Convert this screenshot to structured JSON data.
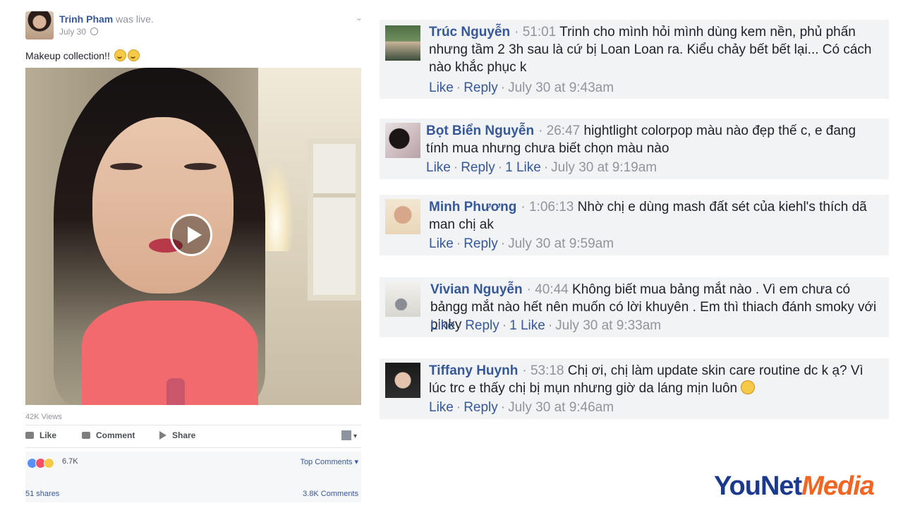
{
  "post": {
    "author": "Trinh Pham",
    "action": "was live.",
    "date": "July 30",
    "caption": "Makeup collection!!",
    "views": "42K Views",
    "actions": {
      "like": "Like",
      "comment": "Comment",
      "share": "Share"
    },
    "reaction_count": "6.7K",
    "top_comments": "Top Comments",
    "shares": "51 shares",
    "comments_count": "3.8K Comments"
  },
  "comments": [
    {
      "name": "Trúc Nguyễn",
      "timestamp": "51:01",
      "text": "Trinh cho mình hỏi mình dùng kem nền, phủ phấn nhưng tầm 2 3h sau là cứ bị Loan Loan ra. Kiểu chảy bết bết lại... Có cách nào khắc phục k",
      "like": "Like",
      "reply": "Reply",
      "likes": "",
      "time": "July 30 at 9:43am"
    },
    {
      "name": "Bọt Biển Nguyễn",
      "timestamp": "26:47",
      "text": "hightlight colorpop màu nào đẹp thế c, e đang tính mua nhưng chưa biết chọn màu nào",
      "like": "Like",
      "reply": "Reply",
      "likes": "1 Like",
      "time": "July 30 at 9:19am"
    },
    {
      "name": "Minh Phương",
      "timestamp": "1:06:13",
      "text": "Nhờ chị e dùng mash đất sét của kiehl's thích dã man chị ak",
      "like": "Like",
      "reply": "Reply",
      "likes": "",
      "time": "July 30 at 9:59am"
    },
    {
      "name": "Vivian Nguyễn",
      "timestamp": "40:44",
      "text": "Không biết mua bảng mắt nào . Vì em chưa có bảngg mắt nào hết nên muốn có lời khuyên . Em thì thiach đánh smoky với pinky",
      "like": "Like",
      "reply": "Reply",
      "likes": "1 Like",
      "time": "July 30 at 9:33am"
    },
    {
      "name": "Tiffany Huynh",
      "timestamp": "53:18",
      "text": "Chị ơi, chị làm update skin care routine dc k ạ? Vì lúc trc e thấy chị bị mụn nhưng giờ da láng mịn luôn",
      "like": "Like",
      "reply": "Reply",
      "likes": "",
      "time": "July 30 at 9:46am"
    }
  ],
  "watermark": {
    "part1": "YouNet",
    "part2": "Media"
  }
}
